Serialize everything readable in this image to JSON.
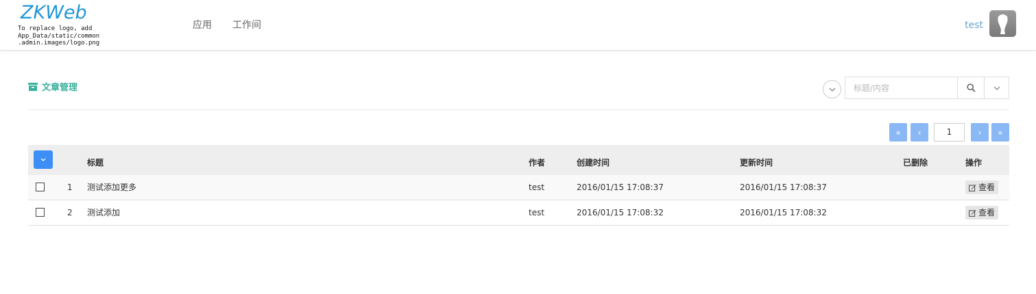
{
  "logo": {
    "text": "ZKWeb",
    "note": "To replace logo, add\nApp_Data/static/common\n.admin.images/logo.png"
  },
  "nav": {
    "items": [
      "应用",
      "工作间"
    ],
    "username": "test"
  },
  "page": {
    "title": "文章管理"
  },
  "search": {
    "placeholder": "标题/内容",
    "value": ""
  },
  "pagination": {
    "current_page": "1",
    "first": "«",
    "prev": "‹",
    "next": "›",
    "last": "»"
  },
  "table": {
    "columns": {
      "title": "标题",
      "author": "作者",
      "created": "创建时间",
      "updated": "更新时间",
      "deleted": "已删除",
      "actions": "操作"
    },
    "rows": [
      {
        "index": "1",
        "title": "测试添加更多",
        "author": "test",
        "created": "2016/01/15 17:08:37",
        "updated": "2016/01/15 17:08:37",
        "deleted": "",
        "action": "查看"
      },
      {
        "index": "2",
        "title": "测试添加",
        "author": "test",
        "created": "2016/01/15 17:08:32",
        "updated": "2016/01/15 17:08:32",
        "deleted": "",
        "action": "查看"
      }
    ]
  },
  "colors": {
    "accent_teal": "#3bb09c",
    "link_blue": "#6aa5d0",
    "button_blue": "#3d8ef5",
    "pager_blue": "#8ab8f5",
    "logo_blue": "#2196d6"
  },
  "icons": {
    "page_title": "archive-icon",
    "search": "search-icon",
    "dropdown": "chevron-down-icon",
    "edit": "edit-icon",
    "avatar": "user-avatar-icon"
  }
}
